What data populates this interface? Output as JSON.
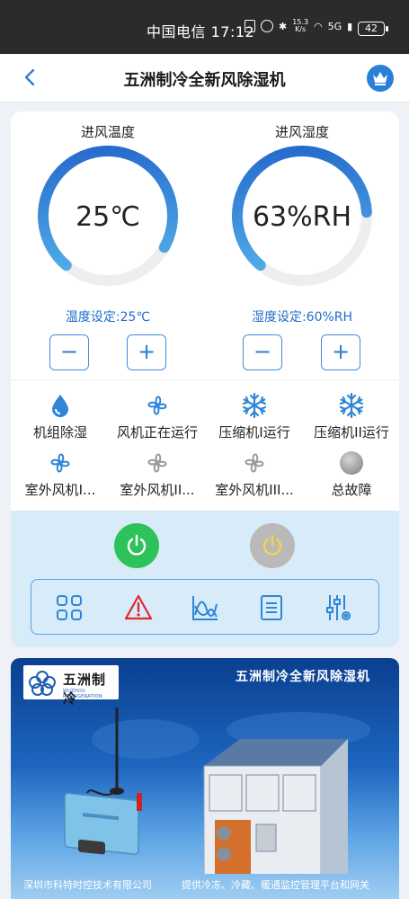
{
  "status_bar": {
    "carrier": "中国电信 17:12",
    "net_speed": "15.3",
    "net_unit": "K/s",
    "network": "5G",
    "battery": "42"
  },
  "header": {
    "title": "五洲制冷全新风除湿机"
  },
  "gauges": [
    {
      "label": "进风温度",
      "value": "25℃",
      "setpoint": "温度设定:25℃",
      "fill_fraction": 0.72
    },
    {
      "label": "进风湿度",
      "value": "63%RH",
      "setpoint": "湿度设定:60%RH",
      "fill_fraction": 0.63
    }
  ],
  "stepper": {
    "minus": "−",
    "plus": "+"
  },
  "status_items": [
    {
      "label": "机组除湿",
      "icon": "water-drop-icon"
    },
    {
      "label": "风机正在运行",
      "icon": "fan-icon"
    },
    {
      "label": "压缩机I运行",
      "icon": "snowflake-icon"
    },
    {
      "label": "压缩机II运行",
      "icon": "snowflake-icon"
    },
    {
      "label": "室外风机I...",
      "icon": "fan-icon"
    },
    {
      "label": "室外风机II...",
      "icon": "fan-icon"
    },
    {
      "label": "室外风机III...",
      "icon": "fan-icon"
    },
    {
      "label": "总故障",
      "icon": "fault-indicator-icon"
    }
  ],
  "controls": {
    "power_on_color": "#2ec25a",
    "power_off_color": "#b9b9b9",
    "tools": [
      "grid-icon",
      "warning-icon",
      "trend-chart-icon",
      "list-icon",
      "settings-sliders-icon"
    ]
  },
  "banner": {
    "logo_cn": "五洲制冷",
    "logo_en": "WUZHOU REFRIGERATION",
    "title": "五洲制冷全新风除湿机",
    "company": "深圳市科特时控技术有限公司",
    "slogan": "提供冷冻、冷藏、暖通监控管理平台和网关"
  },
  "colors": {
    "accent": "#2a7fd6",
    "gauge_track": "#eeeeee",
    "gauge_fill_start": "#1e5fc8",
    "gauge_fill_end": "#5fc1f0",
    "active_icon": "#2f86d8",
    "inactive_icon": "#9a9a9a"
  }
}
